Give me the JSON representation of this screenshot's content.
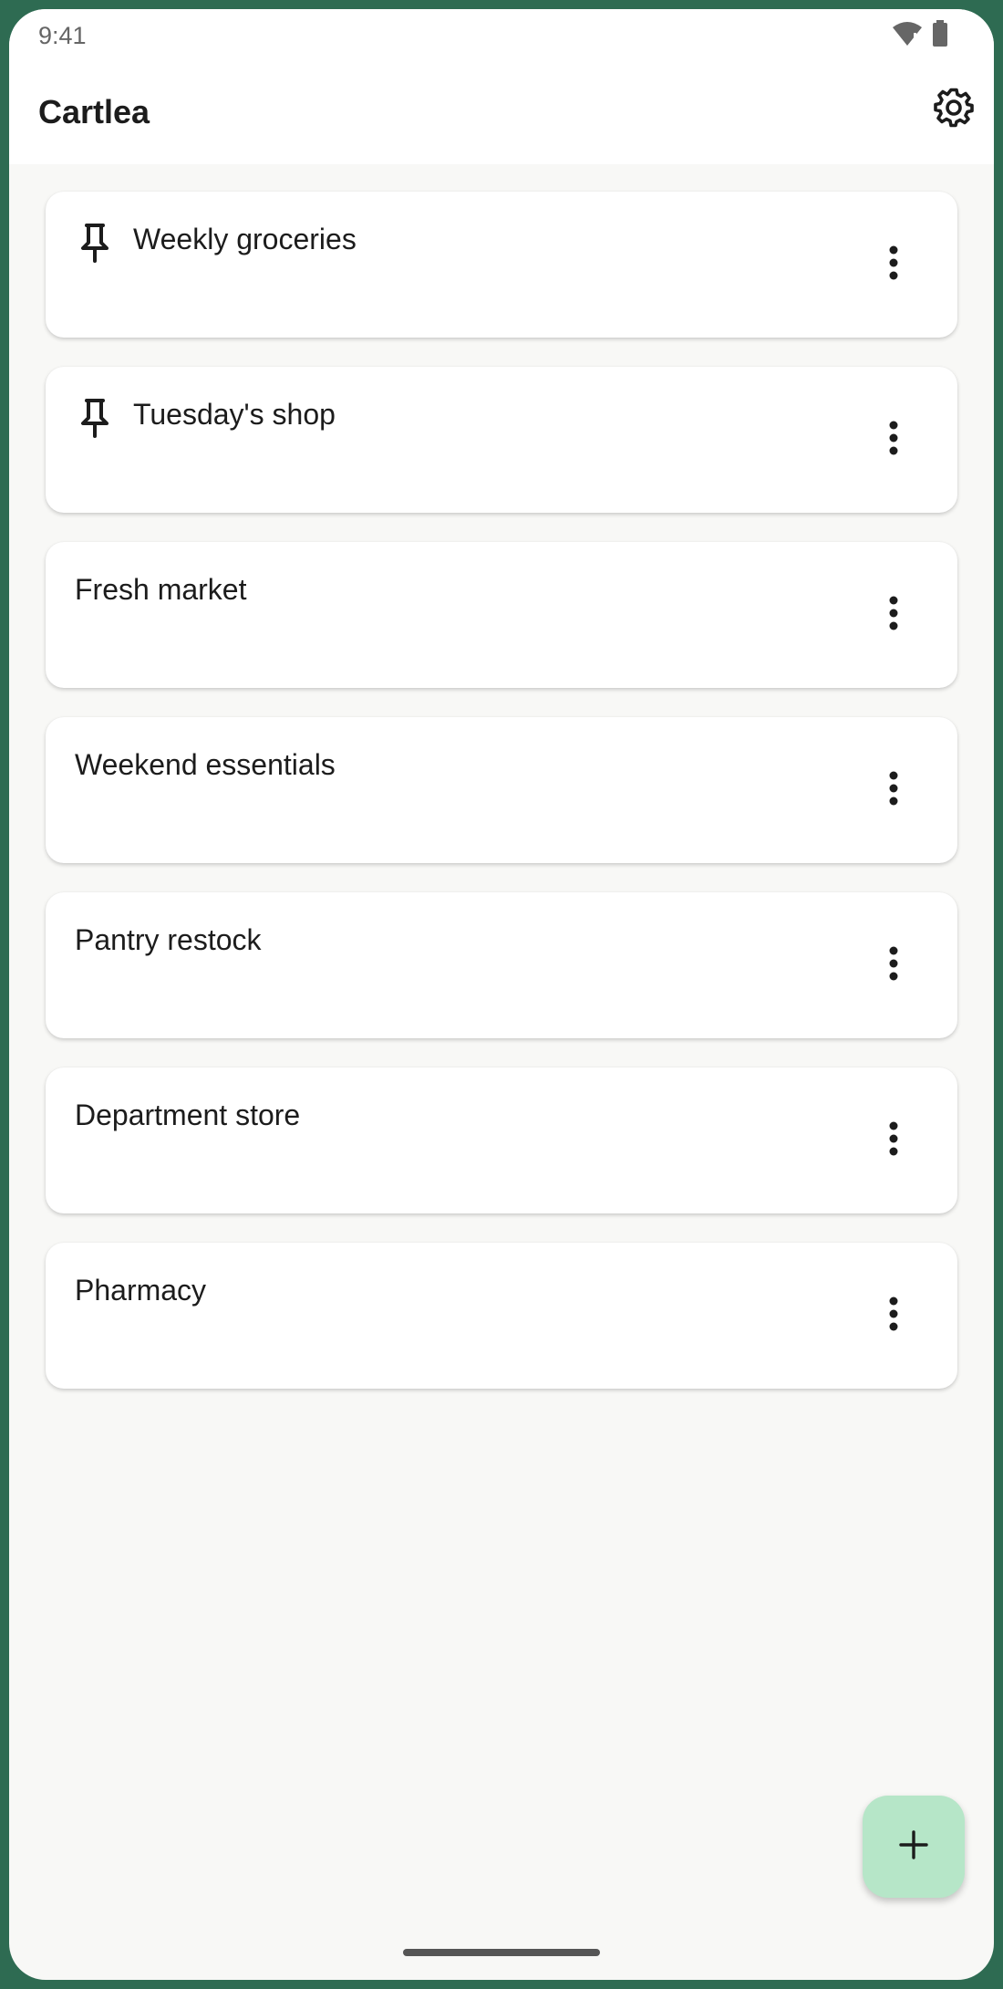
{
  "status_bar": {
    "time": "9:41",
    "icons": [
      "wifi-alert-icon",
      "battery-icon"
    ]
  },
  "app_bar": {
    "title": "Cartlea",
    "settings_icon": "gear-icon"
  },
  "lists": [
    {
      "title": "Weekly groceries",
      "pinned": true
    },
    {
      "title": "Tuesday's shop",
      "pinned": true
    },
    {
      "title": "Fresh market",
      "pinned": false
    },
    {
      "title": "Weekend essentials",
      "pinned": false
    },
    {
      "title": "Pantry restock",
      "pinned": false
    },
    {
      "title": "Department store",
      "pinned": false
    },
    {
      "title": "Pharmacy",
      "pinned": false
    }
  ],
  "fab": {
    "icon": "plus-icon",
    "color": "#b6e6c8"
  },
  "colors": {
    "frame": "#2e6b52",
    "background": "#f8f8f6",
    "card": "#ffffff"
  }
}
